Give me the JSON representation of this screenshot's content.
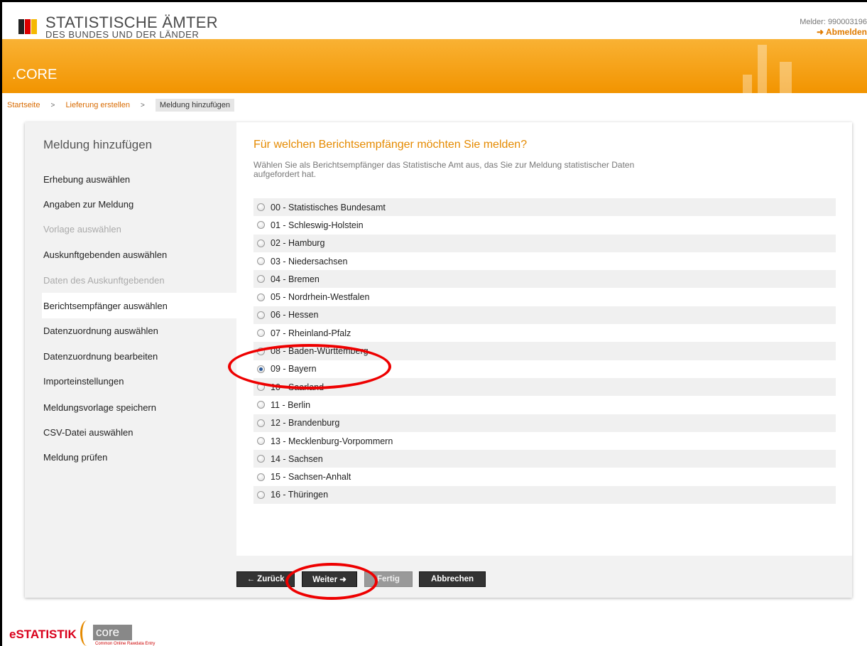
{
  "header": {
    "title": "STATISTISCHE ÄMTER",
    "subtitle": "DES BUNDES UND DER LÄNDER",
    "melder": "Melder: 990003196",
    "logout": "➜ Abmelden"
  },
  "banner": {
    "app_name": ".CORE"
  },
  "breadcrumb": {
    "items": [
      "Startseite",
      "Lieferung erstellen"
    ],
    "separator": ">",
    "current": "Meldung hinzufügen"
  },
  "sidebar": {
    "title": "Meldung hinzufügen",
    "items": [
      {
        "label": "Erhebung auswählen",
        "state": "enabled"
      },
      {
        "label": "Angaben zur Meldung",
        "state": "enabled"
      },
      {
        "label": "Vorlage auswählen",
        "state": "disabled"
      },
      {
        "label": "Auskunftgebenden auswählen",
        "state": "enabled"
      },
      {
        "label": "Daten des Auskunftgebenden",
        "state": "disabled"
      },
      {
        "label": "Berichtsempfänger auswählen",
        "state": "active"
      },
      {
        "label": "Datenzuordnung auswählen",
        "state": "enabled"
      },
      {
        "label": "Datenzuordnung bearbeiten",
        "state": "enabled"
      },
      {
        "label": "Importeinstellungen",
        "state": "enabled"
      },
      {
        "label": "Meldungsvorlage speichern",
        "state": "enabled"
      },
      {
        "label": "CSV-Datei auswählen",
        "state": "enabled"
      },
      {
        "label": "Meldung prüfen",
        "state": "enabled"
      }
    ]
  },
  "main": {
    "question": "Für welchen Berichtsempfänger möchten Sie melden?",
    "hint": "Wählen Sie als Berichtsempfänger das Statistische Amt aus, das Sie zur Meldung statistischer Daten aufgefordert hat.",
    "options": [
      "00 - Statistisches Bundesamt",
      "01 - Schleswig-Holstein",
      "02 - Hamburg",
      "03 - Niedersachsen",
      "04 - Bremen",
      "05 - Nordrhein-Westfalen",
      "06 - Hessen",
      "07 - Rheinland-Pfalz",
      "08 - Baden-Württemberg",
      "09 - Bayern",
      "10 - Saarland",
      "11 - Berlin",
      "12 - Brandenburg",
      "13 - Mecklenburg-Vorpommern",
      "14 - Sachsen",
      "15 - Sachsen-Anhalt",
      "16 - Thüringen"
    ],
    "selected": "09 - Bayern"
  },
  "buttons": {
    "back": "← Zurück",
    "next": "Weiter ➜",
    "finish": "Fertig",
    "cancel": "Abbrechen"
  },
  "footer": {
    "brand": "eSTATISTIK",
    "core": "core",
    "tagline": "Common Online Rawdata Entry"
  },
  "colors": {
    "accent": "#f29400",
    "link": "#d86a00",
    "annotation": "#e00000"
  }
}
